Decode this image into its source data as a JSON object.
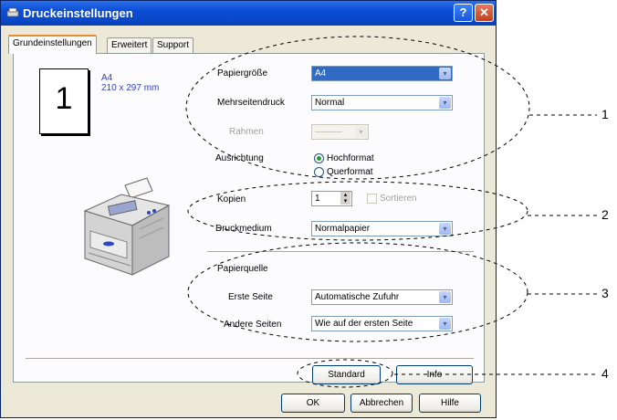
{
  "window": {
    "title": "Druckeinstellungen",
    "help_label": "?",
    "close_label": "✕"
  },
  "tabs": [
    {
      "label": "Grundeinstellungen"
    },
    {
      "label": "Erweitert"
    },
    {
      "label": "Support"
    }
  ],
  "preview": {
    "page_number": "1",
    "size_name": "A4",
    "size_dims": "210 x 297 mm"
  },
  "fields": {
    "papiergroesse": {
      "label": "Papiergröße",
      "value": "A4"
    },
    "mehrseiten": {
      "label": "Mehrseitendruck",
      "value": "Normal"
    },
    "rahmen": {
      "label": "Rahmen",
      "value": "———"
    },
    "ausrichtung": {
      "label": "Ausrichtung",
      "option1": "Hochformat",
      "option2": "Querformat"
    },
    "kopien": {
      "label": "Kopien",
      "value": "1",
      "sort_label": "Sortieren"
    },
    "druckmedium": {
      "label": "Druckmedium",
      "value": "Normalpapier"
    },
    "papierquelle": {
      "label": "Papierquelle"
    },
    "erste_seite": {
      "label": "Erste Seite",
      "value": "Automatische Zufuhr"
    },
    "andere_seiten": {
      "label": "Andere Seiten",
      "value": "Wie auf der ersten Seite"
    }
  },
  "buttons": {
    "standard": "Standard",
    "info": "Info",
    "ok": "OK",
    "cancel": "Abbrechen",
    "help": "Hilfe"
  },
  "callouts": [
    "1",
    "2",
    "3",
    "4"
  ],
  "icons": {
    "arrow": "▾",
    "spin_up": "▴",
    "spin_down": "▾"
  },
  "colors": {
    "title_bar": "#0b4dd6",
    "selection": "#316ac5",
    "preview_text": "#3040c8"
  }
}
